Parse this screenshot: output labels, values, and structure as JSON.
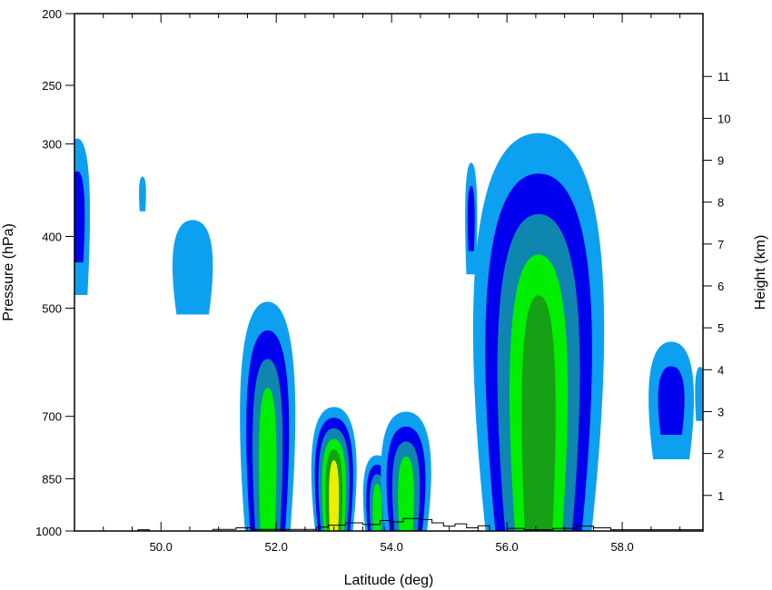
{
  "chart_data": {
    "type": "contour",
    "title": "",
    "xlabel": "Latitude (deg)",
    "ylabel_left": "Pressure (hPa)",
    "ylabel_right": "Height (km)",
    "xlim": [
      48.5,
      59.4
    ],
    "pressure_lim": [
      1000,
      200
    ],
    "pressure_scale": "log",
    "x_ticks": [
      "50.0",
      "52.0",
      "54.0",
      "56.0",
      "58.0"
    ],
    "x_tick_values": [
      50.0,
      52.0,
      54.0,
      56.0,
      58.0
    ],
    "pressure_ticks": [
      200,
      250,
      300,
      400,
      500,
      700,
      850,
      1000
    ],
    "height_ticks": [
      1,
      2,
      3,
      4,
      5,
      6,
      7,
      8,
      9,
      10,
      11
    ],
    "colors": {
      "level1": "#0ea0f0",
      "level2": "#0000ee",
      "level3": "#0e86b0",
      "level4": "#00ee00",
      "level5": "#16a016",
      "level6": "#eeee00",
      "terrain": "#000000",
      "frame": "#000000"
    },
    "cells": [
      {
        "center_lat": 48.55,
        "p_bottom": 480,
        "p_top": 295,
        "halfwidth": 0.25,
        "levels": 2
      },
      {
        "center_lat": 49.68,
        "p_bottom": 370,
        "p_top": 332,
        "halfwidth": 0.07,
        "levels": 1
      },
      {
        "center_lat": 50.55,
        "p_bottom": 510,
        "p_top": 380,
        "halfwidth": 0.4,
        "levels": 1
      },
      {
        "center_lat": 51.85,
        "p_bottom": 1000,
        "p_top": 490,
        "halfwidth": 0.55,
        "levels": 4
      },
      {
        "center_lat": 53.0,
        "p_bottom": 1000,
        "p_top": 680,
        "halfwidth": 0.45,
        "levels": 6
      },
      {
        "center_lat": 53.75,
        "p_bottom": 1000,
        "p_top": 790,
        "halfwidth": 0.28,
        "levels": 4
      },
      {
        "center_lat": 54.25,
        "p_bottom": 1000,
        "p_top": 690,
        "halfwidth": 0.5,
        "levels": 4
      },
      {
        "center_lat": 55.38,
        "p_bottom": 450,
        "p_top": 318,
        "halfwidth": 0.12,
        "levels": 2
      },
      {
        "center_lat": 56.55,
        "p_bottom": 1000,
        "p_top": 290,
        "halfwidth": 1.3,
        "levels": 5
      },
      {
        "center_lat": 58.85,
        "p_bottom": 800,
        "p_top": 555,
        "halfwidth": 0.45,
        "levels": 2
      },
      {
        "center_lat": 59.35,
        "p_bottom": 710,
        "p_top": 600,
        "halfwidth": 0.1,
        "levels": 1
      }
    ],
    "terrain_profile": [
      [
        48.5,
        1000
      ],
      [
        49.5,
        1000
      ],
      [
        49.6,
        996
      ],
      [
        49.75,
        996
      ],
      [
        49.8,
        1000
      ],
      [
        50.8,
        1000
      ],
      [
        50.9,
        995
      ],
      [
        51.2,
        995
      ],
      [
        51.3,
        990
      ],
      [
        51.5,
        990
      ],
      [
        51.6,
        995
      ],
      [
        52.5,
        995
      ],
      [
        52.7,
        988
      ],
      [
        52.9,
        982
      ],
      [
        53.2,
        975
      ],
      [
        53.5,
        980
      ],
      [
        53.8,
        968
      ],
      [
        54.0,
        972
      ],
      [
        54.2,
        962
      ],
      [
        54.5,
        965
      ],
      [
        54.7,
        975
      ],
      [
        54.9,
        985
      ],
      [
        55.1,
        978
      ],
      [
        55.3,
        990
      ],
      [
        55.5,
        984
      ],
      [
        55.7,
        1000
      ],
      [
        56.0,
        992
      ],
      [
        56.3,
        996
      ],
      [
        56.8,
        992
      ],
      [
        57.2,
        985
      ],
      [
        57.5,
        990
      ],
      [
        57.8,
        996
      ],
      [
        58.2,
        996
      ],
      [
        59.4,
        996
      ]
    ]
  }
}
